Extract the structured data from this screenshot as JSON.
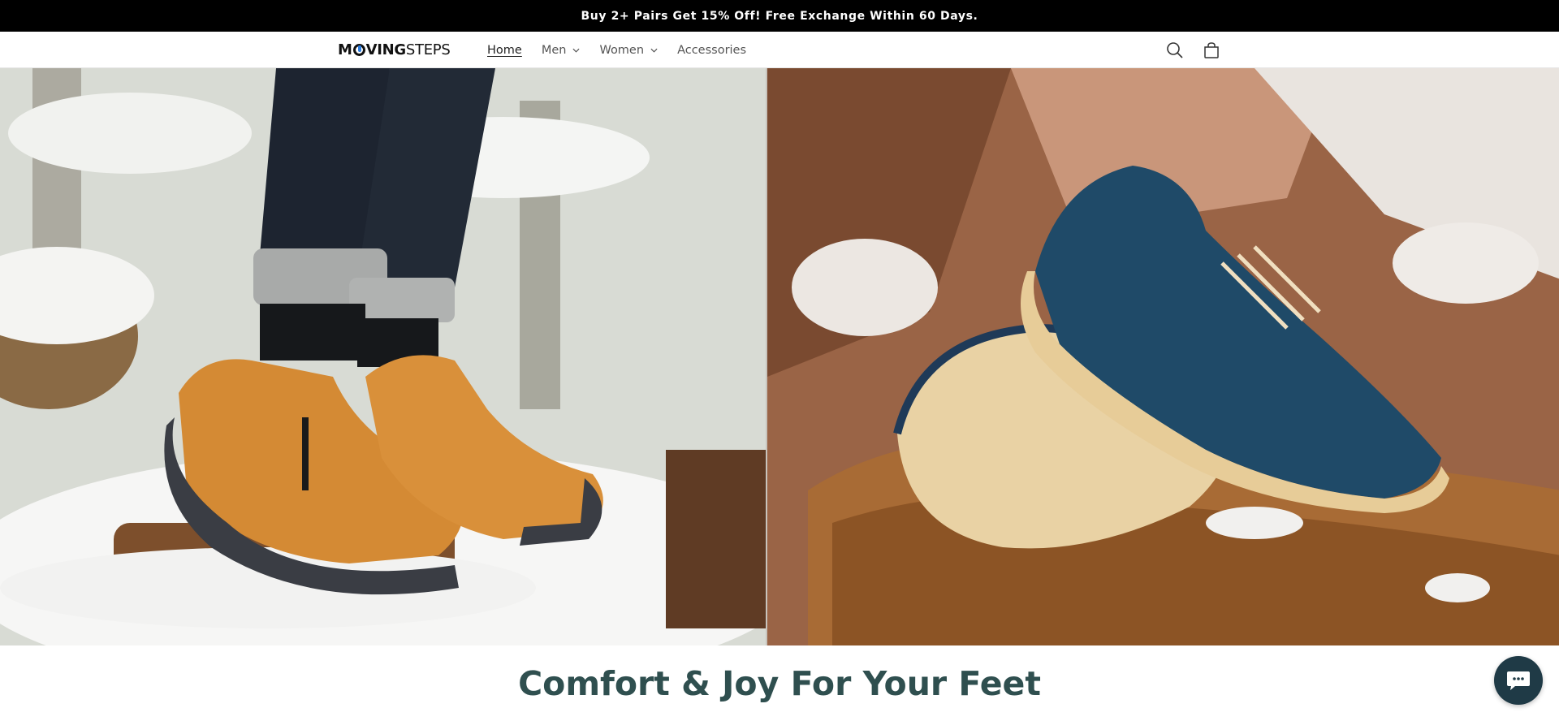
{
  "announcement": "Buy 2+ Pairs Get 15% Off! Free Exchange Within 60 Days.",
  "brand": {
    "part1": "M",
    "part2": "VING",
    "part3": "STEPS"
  },
  "nav": {
    "items": [
      {
        "label": "Home",
        "active": true,
        "has_dropdown": false
      },
      {
        "label": "Men",
        "active": false,
        "has_dropdown": true
      },
      {
        "label": "Women",
        "active": false,
        "has_dropdown": true
      },
      {
        "label": "Accessories",
        "active": false,
        "has_dropdown": false
      }
    ]
  },
  "icons": {
    "search": "search-icon",
    "cart": "cart-icon",
    "chat": "chat-icon"
  },
  "hero": {
    "left_image": "orange winter ankle boots on snow",
    "right_image": "navy blue leather walking shoe on rock"
  },
  "section": {
    "title": "Comfort & Joy For Your Feet"
  },
  "colors": {
    "announcement_bg": "#000000",
    "title": "#2f4f4f",
    "chat_bg": "#1f3a46"
  }
}
